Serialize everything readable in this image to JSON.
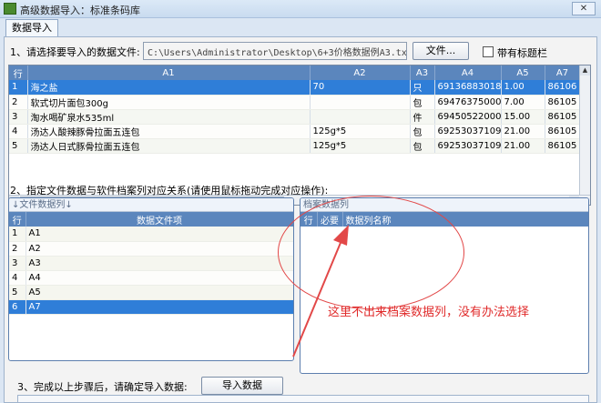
{
  "window": {
    "title": "高级数据导入：标准条码库",
    "close_glyph": "✕"
  },
  "tabs": [
    {
      "label": "数据导入"
    }
  ],
  "step1": {
    "label": "1、请选择要导入的数据文件:",
    "file_path": "C:\\Users\\Administrator\\Desktop\\6+3价格数据例A3.txt",
    "file_button": "文件...",
    "header_checkbox_label": "带有标题栏"
  },
  "file_grid": {
    "headers": [
      "行",
      "A1",
      "A2",
      "A3",
      "A4",
      "A5",
      "A7"
    ],
    "rows": [
      [
        "1",
        "海之盐",
        "70",
        "只",
        "6913688301861",
        "1.00",
        "86106"
      ],
      [
        "2",
        "软式切片面包300g",
        "",
        "包",
        "6947637500050",
        "7.00",
        "86105"
      ],
      [
        "3",
        "淘水喝矿泉水535ml",
        "",
        "件",
        "6945052200072",
        "15.00",
        "86105"
      ],
      [
        "4",
        "汤达人酸辣豚骨拉面五连包",
        "125g*5",
        "包",
        "6925303710910",
        "21.00",
        "86105"
      ],
      [
        "5",
        "汤达人日式豚骨拉面五连包",
        "125g*5",
        "包",
        "6925303710903",
        "21.00",
        "86105"
      ]
    ],
    "selected_row": 0
  },
  "step2": {
    "label": "2、指定文件数据与软件档案列对应关系(请使用鼠标拖动完成对应操作):"
  },
  "file_columns": {
    "title": "↓文件数据列↓",
    "headers": [
      "行",
      "数据文件项"
    ],
    "rows": [
      [
        "1",
        "A1"
      ],
      [
        "2",
        "A2"
      ],
      [
        "3",
        "A3"
      ],
      [
        "4",
        "A4"
      ],
      [
        "5",
        "A5"
      ],
      [
        "6",
        "A7"
      ]
    ],
    "selected_row": 5
  },
  "archive_columns": {
    "title": "档案数据列",
    "headers": [
      "行",
      "必要",
      "数据列名称"
    ]
  },
  "annotation": {
    "text": "这里不出来档案数据列，没有办法选择",
    "color": "#e02a2a"
  },
  "step3": {
    "label": "3、完成以上步骤后，请确定导入数据:",
    "import_button": "导入数据"
  },
  "colors": {
    "header_blue": "#5b86bd",
    "selection_blue": "#2f7ed8",
    "annotation_red": "#e02a2a"
  }
}
